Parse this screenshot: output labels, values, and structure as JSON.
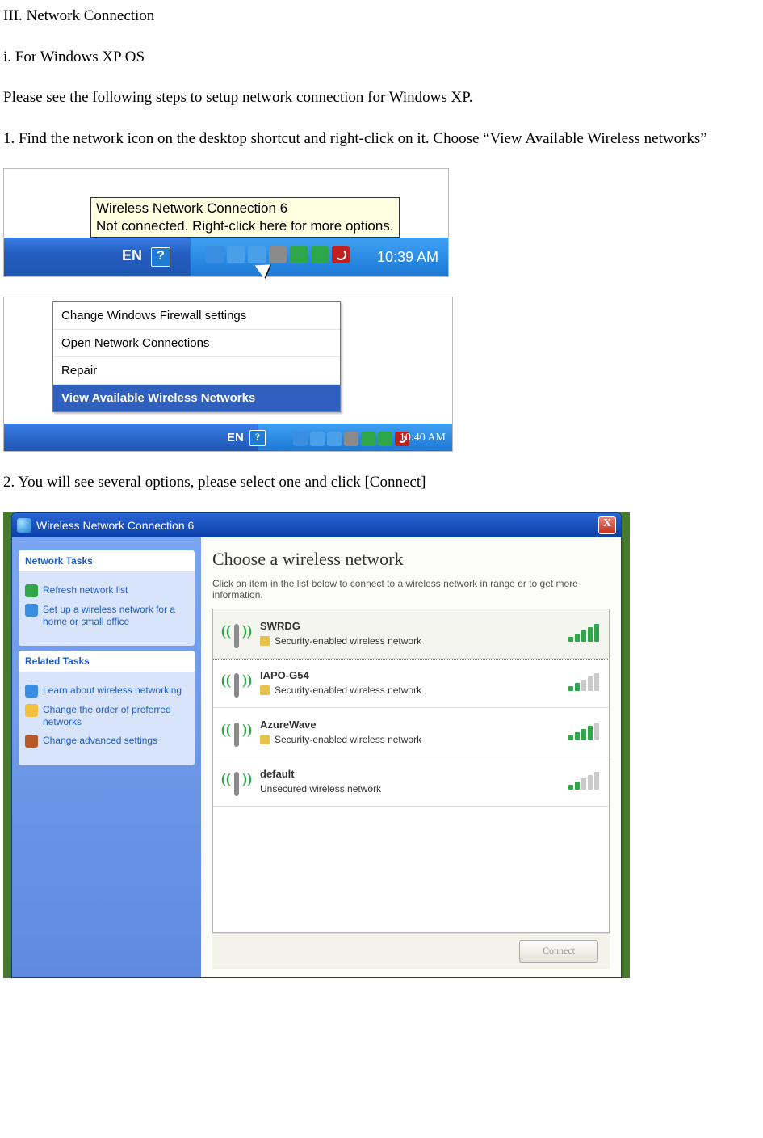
{
  "title": "III. Network Connection",
  "sub": "i. For Windows XP OS",
  "intro": "Please see the following steps to setup network connection for Windows XP.",
  "step1": "1. Find the network icon on the desktop shortcut and right-click on it. Choose “View Available Wireless networks”",
  "step2": "2. You will see several options, please select one and click [Connect]",
  "shot1": {
    "tooltip_line1": "Wireless Network Connection 6",
    "tooltip_line2": "Not connected. Right-click here for more options.",
    "lang": "EN",
    "clock": "10:39 AM"
  },
  "shot2": {
    "menu": {
      "item1": "Change Windows Firewall settings",
      "item2": "Open Network Connections",
      "item3": "Repair",
      "item4": "View Available Wireless Networks"
    },
    "lang": "EN",
    "clock": "10:40 AM"
  },
  "dialog": {
    "title": "Wireless Network Connection 6",
    "side": {
      "hdr1": "Network Tasks",
      "link_refresh": "Refresh network list",
      "link_setup": "Set up a wireless network for a home or small office",
      "hdr2": "Related Tasks",
      "link_learn": "Learn about wireless networking",
      "link_order": "Change the order of preferred networks",
      "link_adv": "Change advanced settings"
    },
    "main": {
      "heading": "Choose a wireless network",
      "hint": "Click an item in the list below to connect to a wireless network in range or to get more information.",
      "secured": "Security-enabled wireless network",
      "unsecured": "Unsecured wireless network",
      "networks": [
        {
          "name": "SWRDG",
          "secure": true,
          "signal": 5
        },
        {
          "name": "IAPO-G54",
          "secure": true,
          "signal": 2
        },
        {
          "name": "AzureWave",
          "secure": true,
          "signal": 4
        },
        {
          "name": "default",
          "secure": false,
          "signal": 2
        }
      ]
    },
    "connect": "Connect"
  }
}
